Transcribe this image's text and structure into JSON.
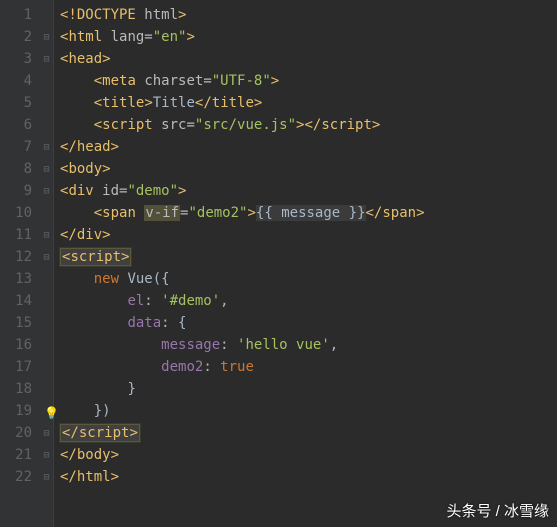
{
  "gutter": {
    "start": 1,
    "end": 22
  },
  "lines": {
    "l1": {
      "indent": 0,
      "html": "<span class='bracket'>&lt;!</span><span class='tag'>DOCTYPE </span><span class='attr-name'>html</span><span class='bracket'>&gt;</span>"
    },
    "l2": {
      "indent": 0,
      "html": "<span class='bracket'>&lt;</span><span class='tag'>html </span><span class='attr-name'>lang=</span><span class='attr-val'>\"en\"</span><span class='bracket'>&gt;</span>"
    },
    "l3": {
      "indent": 0,
      "html": "<span class='bracket'>&lt;</span><span class='tag'>head</span><span class='bracket'>&gt;</span>"
    },
    "l4": {
      "indent": 1,
      "html": "<span class='bracket'>&lt;</span><span class='tag'>meta </span><span class='attr-name'>charset=</span><span class='attr-val'>\"UTF-8\"</span><span class='bracket'>&gt;</span>"
    },
    "l5": {
      "indent": 1,
      "html": "<span class='bracket'>&lt;</span><span class='tag'>title</span><span class='bracket'>&gt;</span><span class='text'>Title</span><span class='bracket'>&lt;/</span><span class='tag'>title</span><span class='bracket'>&gt;</span>"
    },
    "l6": {
      "indent": 1,
      "html": "<span class='bracket'>&lt;</span><span class='tag'>script </span><span class='attr-name'>src=</span><span class='attr-val'>\"src/vue.js\"</span><span class='bracket'>&gt;&lt;/</span><span class='tag'>script</span><span class='bracket'>&gt;</span>"
    },
    "l7": {
      "indent": 0,
      "html": "<span class='bracket'>&lt;/</span><span class='tag'>head</span><span class='bracket'>&gt;</span>"
    },
    "l8": {
      "indent": 0,
      "html": "<span class='bracket'>&lt;</span><span class='tag'>body</span><span class='bracket'>&gt;</span>"
    },
    "l9": {
      "indent": 0,
      "html": "<span class='bracket'>&lt;</span><span class='tag'>div </span><span class='attr-name'>id=</span><span class='attr-val'>\"demo\"</span><span class='bracket'>&gt;</span>"
    },
    "l10": {
      "indent": 1,
      "html": "<span class='bracket'>&lt;</span><span class='tag'>span </span><span class='attr-name hl-warn'>v-if</span><span class='attr-name'>=</span><span class='attr-val'>\"demo2\"</span><span class='bracket'>&gt;</span><span class='mustache'>{{ message }}</span><span class='bracket'>&lt;/</span><span class='tag'>span</span><span class='bracket'>&gt;</span>"
    },
    "l11": {
      "indent": 0,
      "html": "<span class='bracket'>&lt;/</span><span class='tag'>div</span><span class='bracket'>&gt;</span>"
    },
    "l12": {
      "indent": 0,
      "html": "<span class='hl-box'><span class='bracket'>&lt;</span><span class='tag'>script</span><span class='bracket'>&gt;</span></span>"
    },
    "l13": {
      "indent": 1,
      "html": "<span class='keyword'>new </span><span class='class-name'>Vue</span><span class='punct'>({</span>"
    },
    "l14": {
      "indent": 2,
      "html": "<span class='prop'>el</span><span class='punct'>: </span><span class='string'>'#demo'</span><span class='punct'>,</span>"
    },
    "l15": {
      "indent": 2,
      "html": "<span class='prop'>data</span><span class='punct'>: {</span>"
    },
    "l16": {
      "indent": 3,
      "html": "<span class='prop'>message</span><span class='punct'>: </span><span class='string'>'hello vue'</span><span class='punct'>,</span>"
    },
    "l17": {
      "indent": 3,
      "html": "<span class='prop'>demo2</span><span class='punct'>: </span><span class='bool'>true</span>"
    },
    "l18": {
      "indent": 2,
      "html": "<span class='punct'>}</span>"
    },
    "l19": {
      "indent": 1,
      "html": "<span class='punct'>})</span>"
    },
    "l20": {
      "indent": 0,
      "html": "<span class='hl-box'><span class='bracket'>&lt;/</span><span class='tag'>script</span><span class='bracket'>&gt;</span></span>"
    },
    "l21": {
      "indent": 0,
      "html": "<span class='bracket'>&lt;/</span><span class='tag'>body</span><span class='bracket'>&gt;</span>"
    },
    "l22": {
      "indent": 0,
      "html": "<span class='bracket'>&lt;/</span><span class='tag'>html</span><span class='bracket'>&gt;</span>"
    }
  },
  "folds": [
    "",
    "open",
    "open",
    "",
    "",
    "",
    "close",
    "open",
    "open",
    "",
    "close",
    "open",
    "",
    "",
    "",
    "",
    "",
    "",
    "",
    "close",
    "close",
    "close"
  ],
  "bulb_line": 19,
  "watermark": "头条号 / 冰雪缘"
}
